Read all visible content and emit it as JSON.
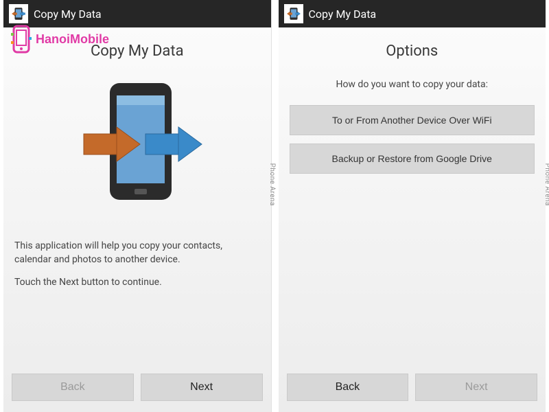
{
  "left": {
    "actionbar_title": "Copy My Data",
    "page_title": "Copy My Data",
    "desc1": "This application will help you copy your contacts, calendar and photos to another device.",
    "desc2": "Touch the Next button to continue.",
    "back_label": "Back",
    "next_label": "Next",
    "side_label": "Phone Arena"
  },
  "right": {
    "actionbar_title": "Copy My Data",
    "page_title": "Options",
    "subtitle": "How do you want to copy your data:",
    "option1": "To or From Another Device Over WiFi",
    "option2": "Backup or Restore from Google Drive",
    "back_label": "Back",
    "next_label": "Next",
    "side_label": "Phone Arena"
  },
  "watermark": {
    "text": "HanoiMobile"
  },
  "colors": {
    "arrow_in": "#c46a2a",
    "arrow_out": "#3a8ac9",
    "phone_body": "#2b2b2b",
    "phone_screen": "#6aa3d4"
  }
}
